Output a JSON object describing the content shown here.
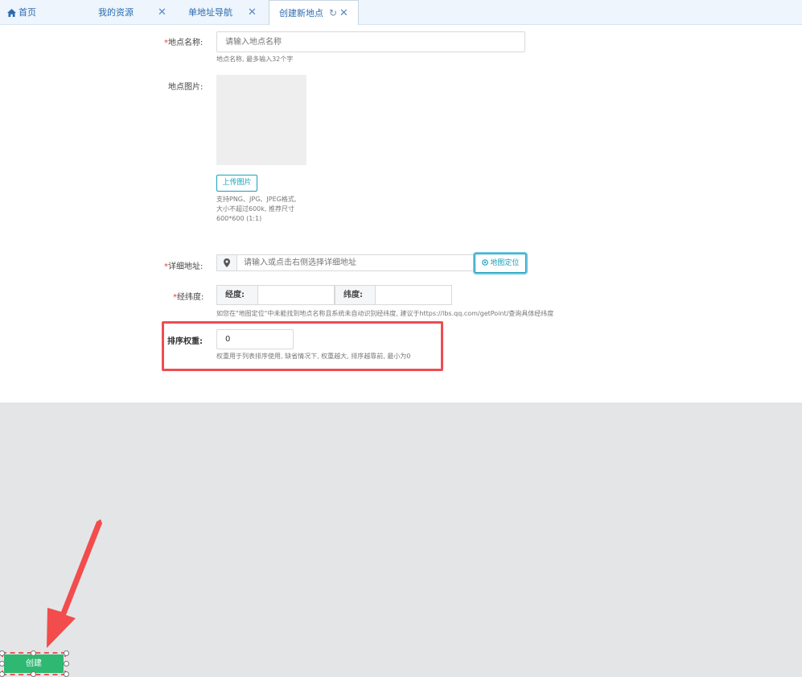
{
  "tabs": [
    {
      "label": "首页",
      "icon": "home-icon"
    },
    {
      "label": "我的资源",
      "close": "✕"
    },
    {
      "label": "单地址导航",
      "close": "✕"
    },
    {
      "label": "创建新地点",
      "close": "✕",
      "refresh": "↻"
    }
  ],
  "form": {
    "name": {
      "required_mark": "*",
      "label": "地点名称:",
      "placeholder": "请输入地点名称",
      "hint": "地点名称, 最多输入32个字"
    },
    "image": {
      "label": "地点图片:",
      "upload_button": "上传图片",
      "hint_lines": [
        "支持PNG、JPG、JPEG格式,",
        "大小不超过600k, 推荐尺寸",
        "600*600 (1:1)"
      ]
    },
    "address": {
      "required_mark": "*",
      "label": "详细地址:",
      "placeholder": "请输入或点击右侧选择详细地址",
      "locate_button": "地图定位"
    },
    "coords": {
      "required_mark": "*",
      "label": "经纬度:",
      "lng_label": "经度:",
      "lat_label": "纬度:",
      "hint": "如您在\"地图定位\"中未能找到地点名称且系统未自动识别经纬度, 建议于https://lbs.qq.com/getPoint/查询具体经纬度"
    },
    "weight": {
      "label": "排序权重:",
      "value": "0",
      "hint": "权重用于列表排序使用, 缺省情况下, 权重越大, 排序越靠前, 最小为0"
    }
  },
  "footer": {
    "create_button": "创建"
  },
  "colors": {
    "accent": "#1aa0b8",
    "tab_text": "#2b6cb0",
    "highlight": "#ee4c52",
    "create": "#2eb872"
  }
}
